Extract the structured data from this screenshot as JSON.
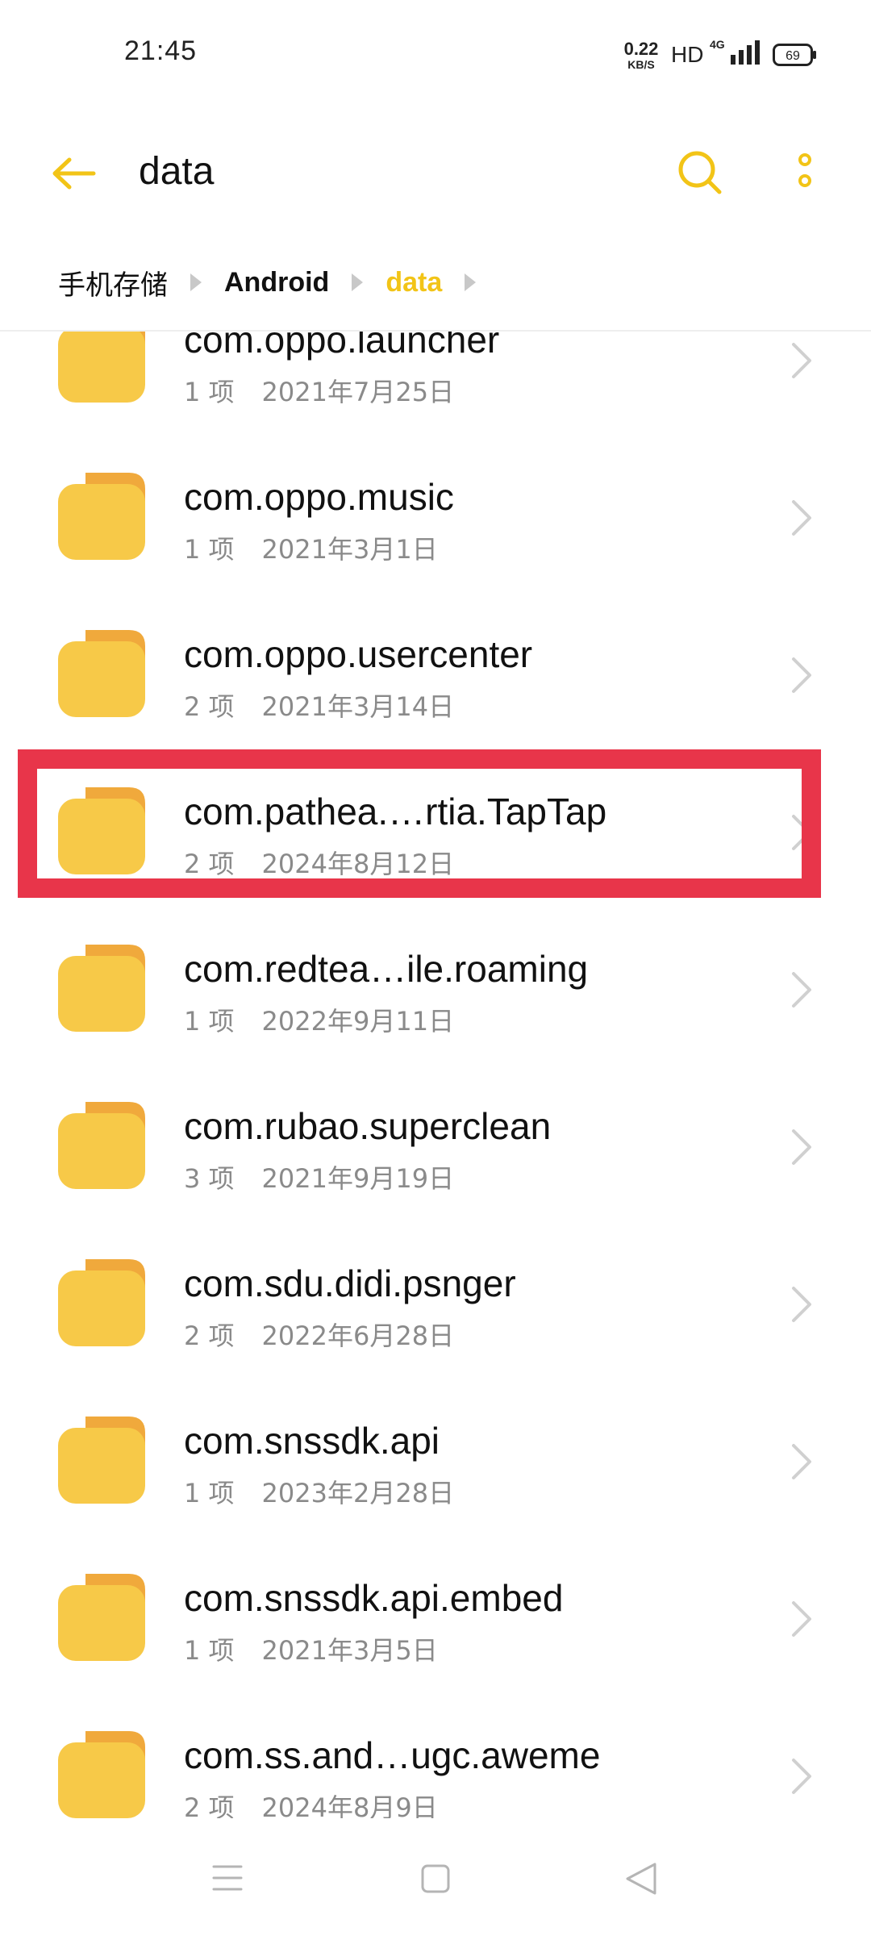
{
  "status_bar": {
    "time": "21:45",
    "net_speed_value": "0.22",
    "net_speed_unit": "KB/S",
    "hd_label": "HD",
    "network_type": "4G",
    "battery_level": "69"
  },
  "toolbar": {
    "title": "data"
  },
  "breadcrumb": {
    "items": [
      "手机存储",
      "Android",
      "data"
    ]
  },
  "files": [
    {
      "name": "com.oppo.launcher",
      "count": "1 项",
      "date": "2021年7月25日"
    },
    {
      "name": "com.oppo.music",
      "count": "1 项",
      "date": "2021年3月1日"
    },
    {
      "name": "com.oppo.usercenter",
      "count": "2 项",
      "date": "2021年3月14日"
    },
    {
      "name": "com.pathea.…rtia.TapTap",
      "count": "2 项",
      "date": "2024年8月12日"
    },
    {
      "name": "com.redtea…ile.roaming",
      "count": "1 项",
      "date": "2022年9月11日"
    },
    {
      "name": "com.rubao.superclean",
      "count": "3 项",
      "date": "2021年9月19日"
    },
    {
      "name": "com.sdu.didi.psnger",
      "count": "2 项",
      "date": "2022年6月28日"
    },
    {
      "name": "com.snssdk.api",
      "count": "1 项",
      "date": "2023年2月28日"
    },
    {
      "name": "com.snssdk.api.embed",
      "count": "1 项",
      "date": "2021年3月5日"
    },
    {
      "name": "com.ss.and…ugc.aweme",
      "count": "2 项",
      "date": "2024年8月9日"
    }
  ],
  "colors": {
    "accent": "#f2c417",
    "folder_body": "#f7c948",
    "folder_tab": "#f0a93c",
    "highlight": "#e8354a"
  },
  "icons": {
    "back": "back-arrow-icon",
    "search": "search-icon",
    "more": "more-vertical-icon",
    "folder": "folder-icon",
    "chevron": "chevron-right-icon"
  }
}
